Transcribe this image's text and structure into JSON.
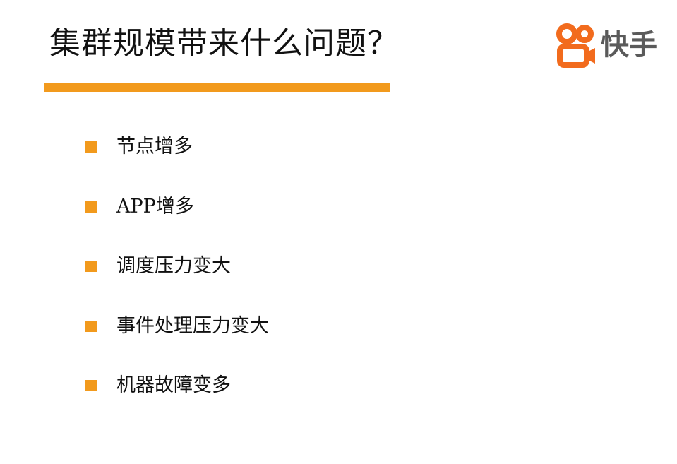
{
  "slide": {
    "title": "集群规模带来什么问题？"
  },
  "logo": {
    "text": "快手"
  },
  "colors": {
    "accent": "#f29a1d",
    "logo_orange": "#f26b1d",
    "logo_gray": "#5a5a5a"
  },
  "bullets": [
    {
      "text": "节点增多"
    },
    {
      "text": "APP增多"
    },
    {
      "text": "调度压力变大"
    },
    {
      "text": "事件处理压力变大"
    },
    {
      "text": "机器故障变多"
    }
  ]
}
